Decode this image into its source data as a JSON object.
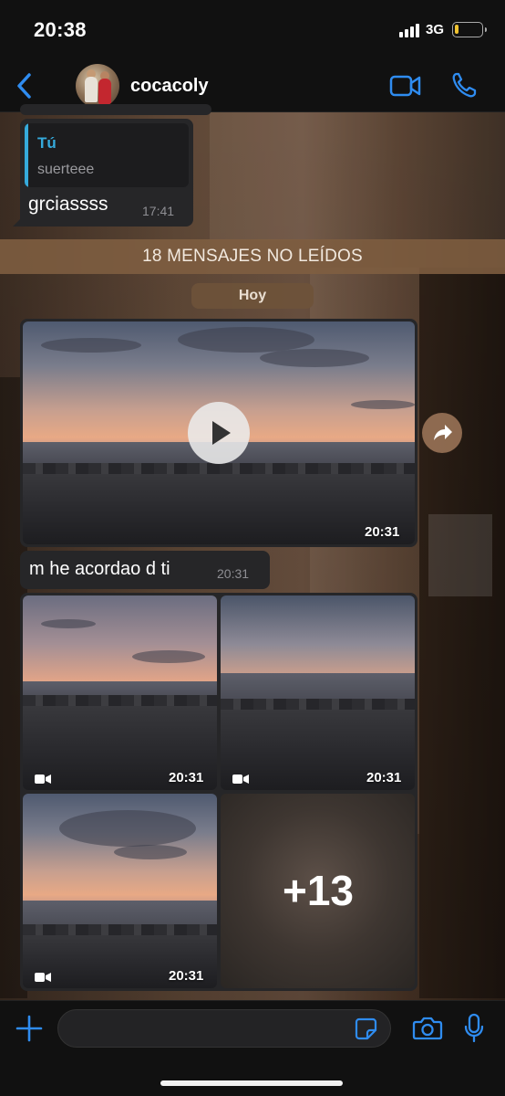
{
  "status_bar": {
    "time": "20:38",
    "network": "3G",
    "battery_level": 0.12,
    "battery_color": "#f0c330"
  },
  "header": {
    "back_icon": "chevron-left-icon",
    "contact_name": "cocacoly",
    "video_call_icon": "video-camera-icon",
    "voice_call_icon": "phone-icon",
    "accent_color": "#2f8cf0"
  },
  "messages": {
    "reply": {
      "quote_author": "Tú",
      "quote_text": "suerteee",
      "text": "grciassss",
      "time": "17:41"
    },
    "unread_banner": "18 MENSAJES NO LEÍDOS",
    "date_chip": "Hoy",
    "video": {
      "time": "20:31",
      "play_icon": "play-icon",
      "forward_icon": "forward-icon"
    },
    "text": {
      "text": "m he acordao d ti",
      "time": "20:31"
    },
    "grid": {
      "items": [
        {
          "type": "video",
          "time": "20:31"
        },
        {
          "type": "video",
          "time": "20:31"
        },
        {
          "type": "video",
          "time": "20:31"
        },
        {
          "type": "more",
          "count_label": "+13"
        }
      ]
    }
  },
  "input_bar": {
    "attach_icon": "plus-icon",
    "placeholder": "",
    "sticker_icon": "sticker-icon",
    "camera_icon": "camera-icon",
    "mic_icon": "microphone-icon"
  }
}
